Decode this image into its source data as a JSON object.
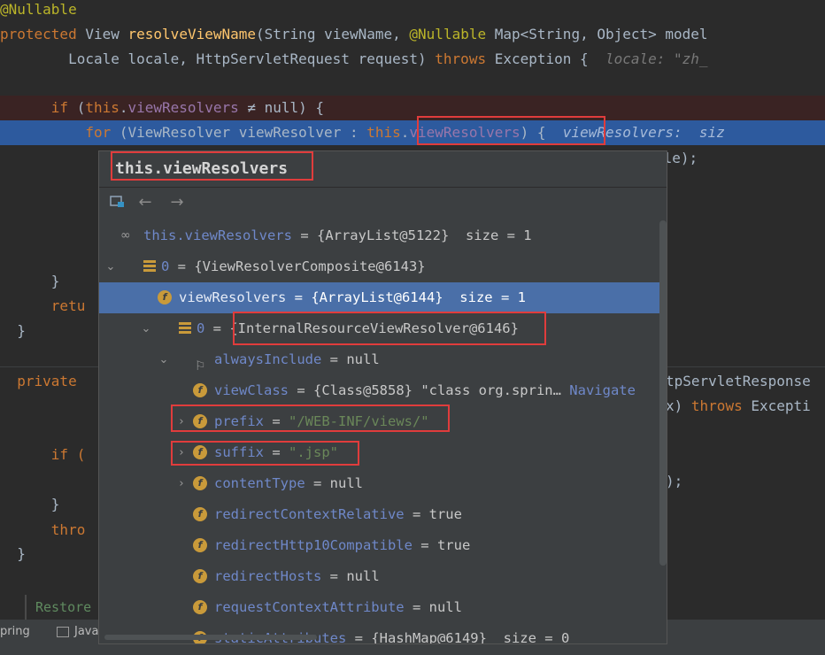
{
  "code": {
    "l1_annotation": "@Nullable",
    "l2_kw": "protected",
    "l2_type": "View",
    "l2_fn": "resolveViewName",
    "l2_rest1": "(String viewName, ",
    "l2_ann": "@Nullable",
    "l2_rest2": " Map<String, Object> model",
    "l3_text": "        Locale locale, HttpServletRequest request) ",
    "l3_throws": "throws",
    "l3_exc": " Exception {  ",
    "l3_hint": "locale: \"zh_",
    "l5_if": "if",
    "l5_open": " (",
    "l5_this": "this",
    "l5_dot": ".",
    "l5_field": "viewResolvers",
    "l5_rest": " ≠ null) {",
    "l6_for": "for",
    "l6_text": " (ViewResolver viewResolver : ",
    "l6_this": "this",
    "l6_dot": ".",
    "l6_field": "viewResolvers",
    "l6_rest": ") {  ",
    "l6_hint": "viewResolvers:  siz",
    "l7_frag": "ale);",
    "l10_brace": "}",
    "l11_return": "retu",
    "l12_brace": "}",
    "l14_private": "private",
    "l14_frag": "tpServletResponse",
    "l15_frag": "x) ",
    "l15_throws": "throws",
    "l15_exc": " Excepti",
    "l17_if": "if (",
    "l18_frag": ");",
    "l19_brace": "}",
    "l20_thro": "thro",
    "l21_brace": "}",
    "restore": "Restore",
    "status_left": "pring",
    "status_java": "Java"
  },
  "popup": {
    "title": "this.viewResolvers",
    "rows": [
      {
        "name": "this.viewResolvers",
        "eq": " = ",
        "val": "{ArrayList@5122}  size = 1"
      },
      {
        "name": "0",
        "eq": " = ",
        "val": "{ViewResolverComposite@6143}"
      },
      {
        "name": "viewResolvers",
        "eq": " = ",
        "val": "{ArrayList@6144}  size = 1"
      },
      {
        "name": "0",
        "eq": " = ",
        "val": "{InternalResourceViewResolver@6146}"
      },
      {
        "name": "alwaysInclude",
        "eq": " = ",
        "val": "null"
      },
      {
        "name": "viewClass",
        "eq": " = ",
        "val": "{Class@5858} \"class org.sprin… ",
        "link": "Navigate"
      },
      {
        "name": "prefix",
        "eq": " = ",
        "str": "\"/WEB-INF/views/\""
      },
      {
        "name": "suffix",
        "eq": " = ",
        "str": "\".jsp\""
      },
      {
        "name": "contentType",
        "eq": " = ",
        "val": "null"
      },
      {
        "name": "redirectContextRelative",
        "eq": " = ",
        "val": "true"
      },
      {
        "name": "redirectHttp10Compatible",
        "eq": " = ",
        "val": "true"
      },
      {
        "name": "redirectHosts",
        "eq": " = ",
        "val": "null"
      },
      {
        "name": "requestContextAttribute",
        "eq": " = ",
        "val": "null"
      },
      {
        "name": "staticAttributes",
        "eq": " = ",
        "val": "{HashMap@6149}  size = 0"
      }
    ]
  },
  "icons": {
    "pin": "pin-icon",
    "back": "back-arrow-icon",
    "forward": "forward-arrow-icon"
  },
  "colors": {
    "editor_bg": "#2b2b2b",
    "selection": "#2d5a9e",
    "highlight_box": "#e03c3c",
    "keyword": "#cc7832",
    "field": "#9876aa"
  }
}
